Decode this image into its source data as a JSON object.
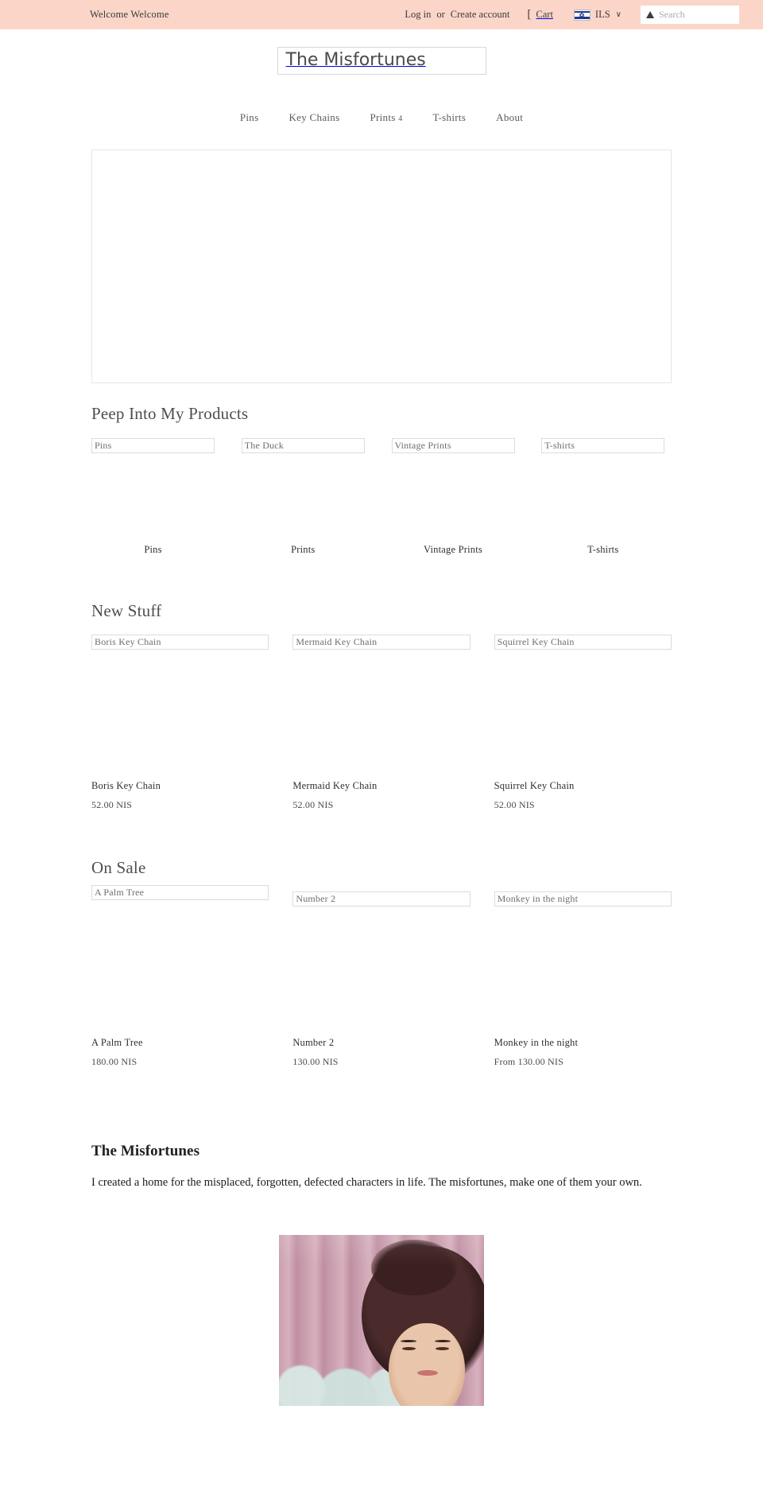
{
  "topbar": {
    "welcome": "Welcome Welcome",
    "login_label": "Log in",
    "separator": "or",
    "create_account_label": "Create account",
    "cart_icon": "cart-icon",
    "cart_label": "Cart",
    "flag_icon": "israel-flag-icon",
    "currency": "ILS",
    "currency_caret": "∨",
    "search_icon": "search-icon",
    "search_value": "",
    "search_placeholder": "Search",
    "background_color": "#fbd6c8"
  },
  "header": {
    "logo_alt": "The Misfortunes"
  },
  "nav": {
    "items": [
      {
        "label": "Pins",
        "badge": ""
      },
      {
        "label": "Key Chains",
        "badge": ""
      },
      {
        "label": "Prints",
        "badge": "4"
      },
      {
        "label": "T-shirts",
        "badge": ""
      },
      {
        "label": "About",
        "badge": ""
      }
    ]
  },
  "hero": {
    "alt": ""
  },
  "collections_section": {
    "title": "Peep Into My Products",
    "items": [
      {
        "image_alt": "Pins",
        "label": "Pins"
      },
      {
        "image_alt": "The Duck",
        "label": "Prints"
      },
      {
        "image_alt": "Vintage Prints",
        "label": "Vintage Prints"
      },
      {
        "image_alt": "T-shirts",
        "label": "T-shirts"
      }
    ]
  },
  "new_stuff_section": {
    "title": "New Stuff",
    "products": [
      {
        "image_alt": "Boris Key Chain",
        "title": "Boris Key Chain",
        "price": "52.00 NIS"
      },
      {
        "image_alt": "Mermaid Key Chain",
        "title": "Mermaid Key Chain",
        "price": "52.00 NIS"
      },
      {
        "image_alt": "Squirrel Key Chain",
        "title": "Squirrel Key Chain",
        "price": "52.00 NIS"
      }
    ]
  },
  "on_sale_section": {
    "title": "On Sale",
    "products": [
      {
        "image_alt": "A Palm Tree",
        "title": "A Palm Tree",
        "price": "180.00 NIS"
      },
      {
        "image_alt": "Number 2",
        "title": "Number 2",
        "price": "130.00 NIS"
      },
      {
        "image_alt": "Monkey in the night",
        "title": "Monkey in the night",
        "price": "From 130.00 NIS"
      }
    ]
  },
  "about": {
    "title": "The Misfortunes",
    "body": "I created a home for the misplaced, forgotten, defected characters in life. The misfortunes, make one of them your own."
  },
  "photo": {
    "alt": "portrait-photo"
  }
}
